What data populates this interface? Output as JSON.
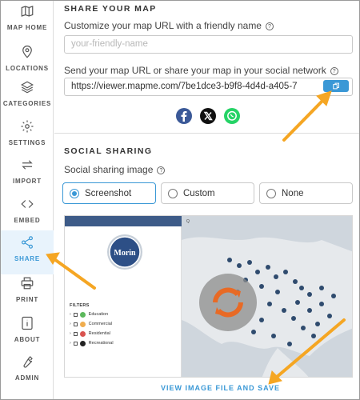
{
  "sidebar": {
    "items": [
      {
        "label": "MAP HOME",
        "icon": "map-icon"
      },
      {
        "label": "LOCATIONS",
        "icon": "location-pin-icon"
      },
      {
        "label": "CATEGORIES",
        "icon": "layers-icon"
      },
      {
        "label": "SETTINGS",
        "icon": "gear-icon"
      },
      {
        "label": "IMPORT",
        "icon": "import-arrows-icon"
      },
      {
        "label": "EMBED",
        "icon": "code-brackets-icon"
      },
      {
        "label": "SHARE",
        "icon": "share-icon",
        "active": true
      },
      {
        "label": "PRINT",
        "icon": "printer-icon"
      },
      {
        "label": "ABOUT",
        "icon": "info-icon"
      },
      {
        "label": "ADMIN",
        "icon": "wrench-icon"
      }
    ]
  },
  "share_map": {
    "title": "SHARE YOUR MAP",
    "friendly_label": "Customize your map URL with a friendly name",
    "friendly_placeholder": "your-friendly-name",
    "url_label": "Send your map URL or share your map in your social network",
    "url_value": "https://viewer.mapme.com/7be1dce3-b9f8-4d4d-a405-7"
  },
  "social_networks": [
    "facebook-icon",
    "x-icon",
    "whatsapp-icon"
  ],
  "social_sharing": {
    "title": "SOCIAL SHARING",
    "image_label": "Social sharing image",
    "options": [
      "Screenshot",
      "Custom",
      "None"
    ],
    "selected": "Screenshot",
    "view_link": "VIEW IMAGE FILE AND SAVE"
  },
  "preview": {
    "logo_text": "Morin",
    "filters_title": "FILTERS",
    "filters": [
      {
        "label": "Education",
        "color": "#5cb85c"
      },
      {
        "label": "Commercial",
        "color": "#f0ad4e"
      },
      {
        "label": "Residential",
        "color": "#d9534f"
      },
      {
        "label": "Recreational",
        "color": "#222222"
      }
    ]
  },
  "colors": {
    "accent": "#3a98d6",
    "annotation_arrow": "#f5a623",
    "facebook": "#3b5998",
    "whatsapp": "#25d366"
  }
}
